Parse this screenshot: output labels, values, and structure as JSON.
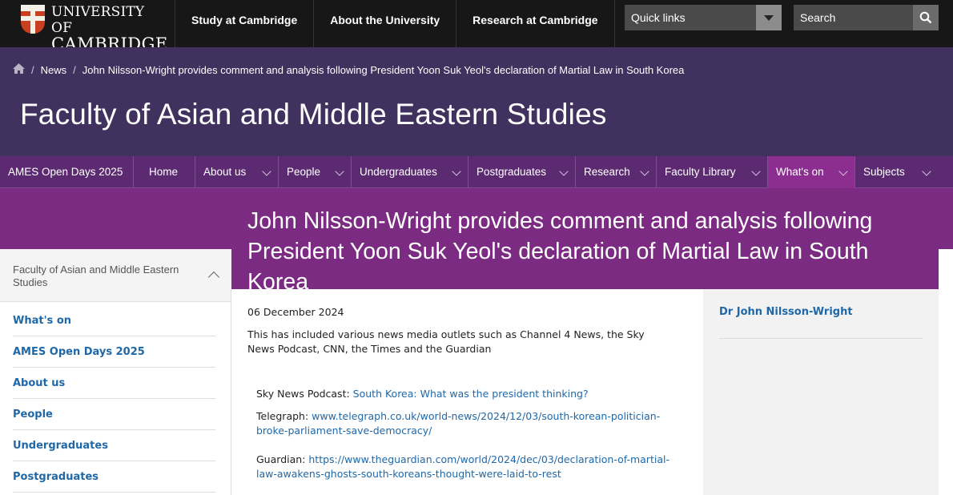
{
  "brand": {
    "line1": "UNIVERSITY OF",
    "line2": "CAMBRIDGE"
  },
  "topnav": [
    {
      "label": "Study at Cambridge"
    },
    {
      "label": "About the University"
    },
    {
      "label": "Research at Cambridge"
    }
  ],
  "quicklinks": {
    "label": "Quick links"
  },
  "search": {
    "placeholder": "Search"
  },
  "breadcrumb": {
    "news": "News",
    "current": "John Nilsson-Wright provides comment and analysis following President Yoon Suk Yeol's declaration of Martial Law in South Korea"
  },
  "faculty_title": "Faculty of Asian and Middle Eastern Studies",
  "secnav": [
    {
      "label": "AMES Open Days 2025"
    },
    {
      "label": "Home"
    },
    {
      "label": "About us"
    },
    {
      "label": "People"
    },
    {
      "label": "Undergraduates"
    },
    {
      "label": "Postgraduates"
    },
    {
      "label": "Research"
    },
    {
      "label": "Faculty Library"
    },
    {
      "label": "What's on"
    },
    {
      "label": "Subjects"
    }
  ],
  "article": {
    "title": "John Nilsson-Wright provides comment and analysis following President Yoon Suk Yeol's declaration of Martial Law in South Korea",
    "date": "06 December 2024",
    "intro": "This has included various news media outlets such as Channel 4 News, the Sky News Podcast, CNN, the Times and the Guardian",
    "links": [
      {
        "source": "Sky News Podcast:",
        "text": "South Korea: What was the president thinking?"
      },
      {
        "source": "Telegraph:",
        "text": "www.telegraph.co.uk/world-news/2024/12/03/south-korean-politician-broke-parliament-save-democracy/"
      },
      {
        "source": "Guardian:",
        "text": "https://www.theguardian.com/world/2024/dec/03/declaration-of-martial-law-awakens-ghosts-south-koreans-thought-were-laid-to-rest"
      }
    ]
  },
  "sidebar": {
    "heading": "Faculty of Asian and Middle Eastern Studies",
    "items": [
      {
        "label": "What's on"
      },
      {
        "label": "AMES Open Days 2025"
      },
      {
        "label": "About us"
      },
      {
        "label": "People"
      },
      {
        "label": "Undergraduates"
      },
      {
        "label": "Postgraduates"
      }
    ]
  },
  "aside": {
    "person": "Dr John Nilsson-Wright"
  },
  "icons": {
    "shield": "university-shield-icon",
    "home": "home-icon",
    "search": "search-icon",
    "dropdown": "chevron-down-icon",
    "collapse": "chevron-up-icon"
  },
  "colors": {
    "topbar": "#171717",
    "header": "#40315e",
    "secnav": "#5b2a71",
    "banner": "#7b2c82",
    "active_tab": "#8b2e8f",
    "link": "#1f68a8"
  }
}
